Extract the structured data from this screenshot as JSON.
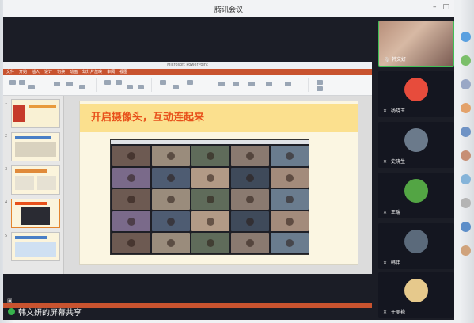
{
  "window": {
    "title": "腾讯会议"
  },
  "share": {
    "label": "韩文妍的屏幕共享",
    "ppt": {
      "title": "Microsoft PowerPoint",
      "tabs": [
        "文件",
        "开始",
        "插入",
        "设计",
        "切换",
        "动画",
        "幻灯片放映",
        "审阅",
        "视图"
      ],
      "thumbnail_numbers": [
        "1",
        "2",
        "3",
        "4",
        "5"
      ],
      "slide_title": "开启摄像头，互动连起来",
      "gallery_cells": 25
    }
  },
  "participants": [
    {
      "name": "韩文妍",
      "icon": "mic-icon",
      "active": true,
      "avatar_color": "#c9a692"
    },
    {
      "name": "杨晓玉",
      "icon": "mic-muted-icon",
      "active": false,
      "avatar_color": "#e74c3c"
    },
    {
      "name": "史晓生",
      "icon": "mic-muted-icon",
      "active": false,
      "avatar_color": "#6b7a8b"
    },
    {
      "name": "王瑞",
      "icon": "mic-muted-icon",
      "active": false,
      "avatar_color": "#53a544"
    },
    {
      "name": "韩伟",
      "icon": "mic-muted-icon",
      "active": false,
      "avatar_color": "#5b6a7b"
    },
    {
      "name": "于丽艳",
      "icon": "mic-muted-icon",
      "active": false,
      "avatar_color": "#e6c98c"
    }
  ],
  "colors": {
    "accent_green": "#3fbe56",
    "slide_title": "#e8511b",
    "ppt_ribbon": "#c8532f"
  }
}
